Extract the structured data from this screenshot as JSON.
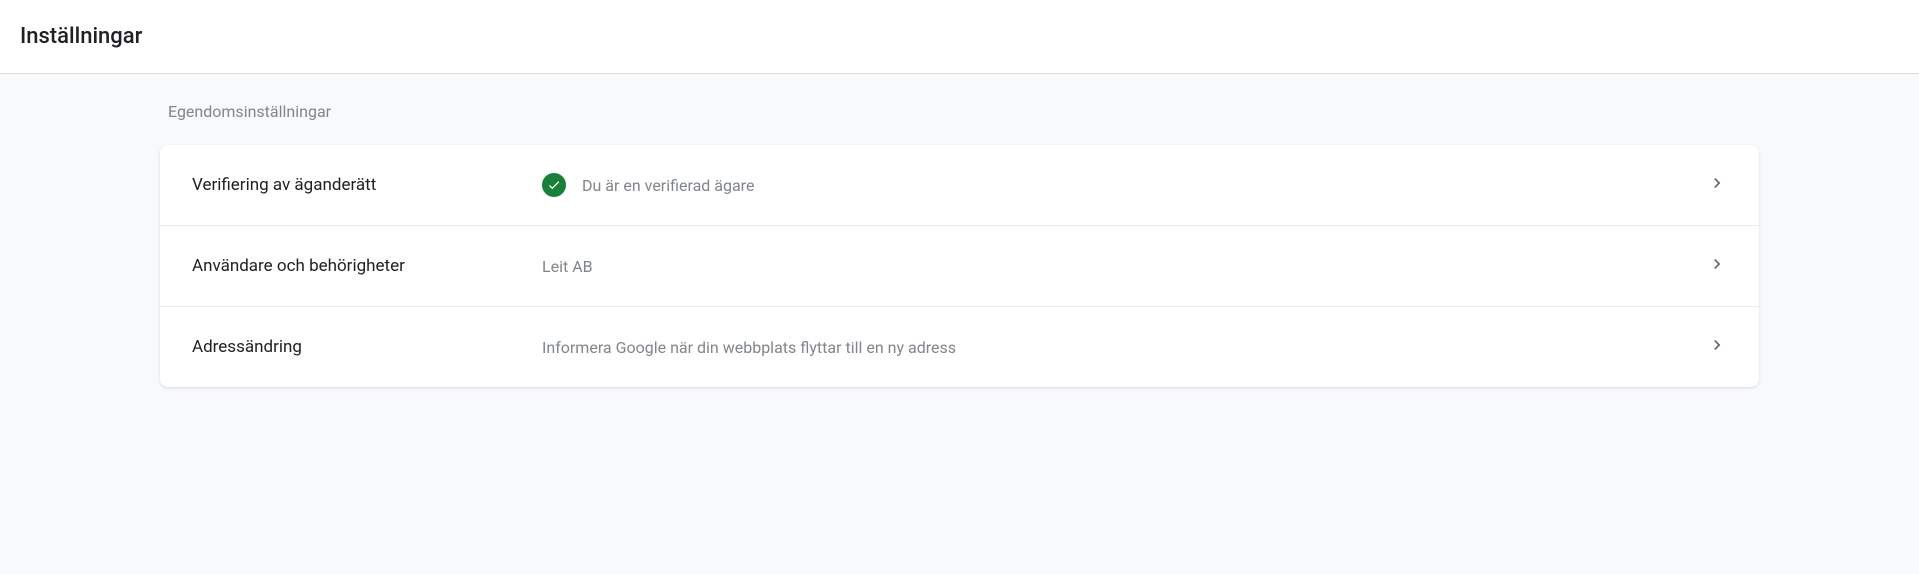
{
  "header": {
    "title": "Inställningar"
  },
  "settings": {
    "section_title": "Egendomsinställningar",
    "rows": [
      {
        "label": "Verifiering av äganderätt",
        "value": "Du är en verifierad ägare",
        "has_check": true
      },
      {
        "label": "Användare och behörigheter",
        "value": "Leit AB",
        "has_check": false
      },
      {
        "label": "Adressändring",
        "value": "Informera Google när din webbplats flyttar till en ny adress",
        "has_check": false
      }
    ]
  }
}
